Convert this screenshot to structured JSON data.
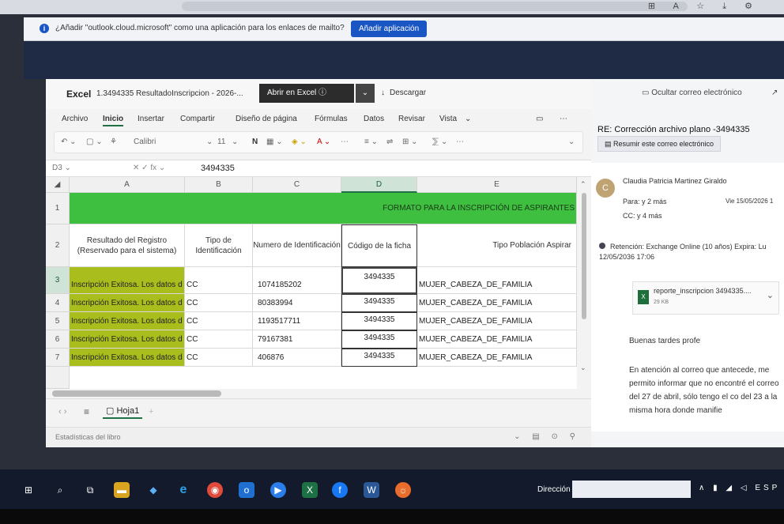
{
  "browser": {
    "notification": "¿Añadir \"outlook.cloud.microsoft\" como una aplicación para los enlaces de mailto?",
    "add_app_button": "Añadir aplicación"
  },
  "excel": {
    "app_name": "Excel",
    "file_name": "1.3494335 ResultadoInscripcion - 2026-...",
    "open_in_excel": "Abrir en Excel",
    "download": "Descargar",
    "menu": [
      "Archivo",
      "Inicio",
      "Insertar",
      "Compartir",
      "Diseño de página",
      "Fórmulas",
      "Datos",
      "Revisar",
      "Vista"
    ],
    "active_menu": "Inicio",
    "font_name": "Calibri",
    "font_size": "11",
    "formula_value": "3494335",
    "columns": [
      "A",
      "B",
      "C",
      "D",
      "E"
    ],
    "rows": [
      "1",
      "2",
      "3",
      "4",
      "5",
      "6",
      "7"
    ],
    "banner": "FORMATO PARA LA INSCRIPCIÓN DE ASPIRANTES",
    "headers": [
      "Resultado del Registro (Reservado para el sistema)",
      "Tipo de Identificación",
      "Numero de Identificación",
      "Código de la ficha",
      "Tipo Población Aspirar"
    ],
    "data_rows": [
      [
        "Inscripción Exitosa. Los datos d",
        "CC",
        "1074185202",
        "3494335",
        "MUJER_CABEZA_DE_FAMILIA"
      ],
      [
        "Inscripción Exitosa. Los datos d",
        "CC",
        "80383994",
        "3494335",
        "MUJER_CABEZA_DE_FAMILIA"
      ],
      [
        "Inscripción Exitosa. Los datos d",
        "CC",
        "1193517711",
        "3494335",
        "MUJER_CABEZA_DE_FAMILIA"
      ],
      [
        "Inscripción Exitosa. Los datos d",
        "CC",
        "79167381",
        "3494335",
        "MUJER_CABEZA_DE_FAMILIA"
      ],
      [
        "Inscripción Exitosa. Los datos d",
        "CC",
        "406876",
        "3494335",
        "MUJER_CABEZA_DE_FAMILIA"
      ]
    ],
    "sheet_tab": "Hoja1",
    "status": "Estadísticas del libro"
  },
  "outlook": {
    "hide_email": "Ocultar correo electrónico",
    "subject": "RE: Corrección archivo plano -3494335",
    "summarize": "Resumir este correo electrónico",
    "avatar_initial": "C",
    "sender": "Claudia Patricia Martinez Giraldo",
    "to": "Para: y 2 más",
    "date": "Vie 15/05/2026 1",
    "cc": "CC: y 4 más",
    "retention": "Retención: Exchange Online (10 años) Expira: Lu 12/05/2036 17:06",
    "attachment_name": "reporte_inscripcion 3494335....",
    "attachment_size": "29 KB",
    "greeting": "Buenas tardes profe",
    "body": "En atención al correo que antecede, me permito informar que no encontré el correo del 27 de abril, sólo tengo el co del 23 a la misma hora donde manifie"
  },
  "taskbar": {
    "address_label": "Dirección",
    "tray_lang": "ESP"
  },
  "colors": {
    "excel_green": "#1e7145",
    "banner_green": "#3fbf3f",
    "result_olive": "#a9bd1d",
    "accent_blue": "#1a55c4"
  }
}
